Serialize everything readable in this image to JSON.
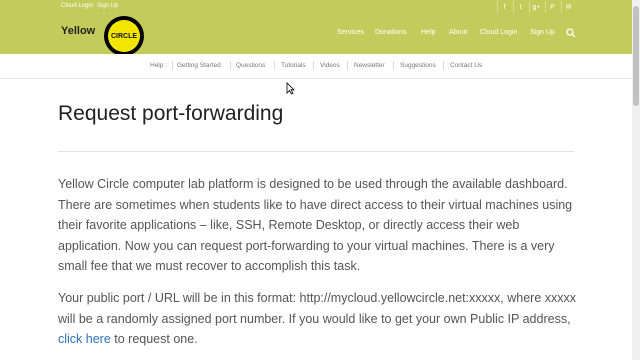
{
  "topbar": {
    "cloud_login": "Cloud Login",
    "sign_up": "Sign Up",
    "social_icons": [
      "facebook-icon",
      "twitter-icon",
      "google-plus-icon",
      "pinterest-icon",
      "email-icon"
    ],
    "social_glyphs": [
      "f",
      "t",
      "g+",
      "P",
      "✉"
    ]
  },
  "logo": {
    "text": "Yellow",
    "circle_text": "CIRCLE"
  },
  "mainnav": {
    "items": [
      "Services",
      "Donations",
      "Help",
      "About",
      "Cloud Login",
      "Sign Up"
    ]
  },
  "subnav": {
    "items": [
      "Help :",
      "Getting Started",
      "Questions",
      "Tutorials",
      "Videos",
      "Newsletter",
      "Suggestions",
      "Contact Us"
    ]
  },
  "content": {
    "title": "Request port-forwarding",
    "para1": "Yellow Circle computer lab platform is designed to be used through the available dashboard. There are sometimes when students like to have direct access to their virtual machines using their favorite applications – like, SSH, Remote Desktop, or directly access their web application. Now you can request port-forwarding to your virtual machines. There is a very small fee that we must recover to accomplish this task.",
    "para2_before": "Your public port / URL will be in this format: http://mycloud.yellowcircle.net:xxxxx, where xxxxx will be a randomly assigned port number. If you would like to get your own Public IP address, ",
    "para2_link": "click here",
    "para2_after": " to request one."
  },
  "colors": {
    "header": "#c3cc5a",
    "logo_yellow": "#f2e600",
    "link": "#2f73b8"
  }
}
